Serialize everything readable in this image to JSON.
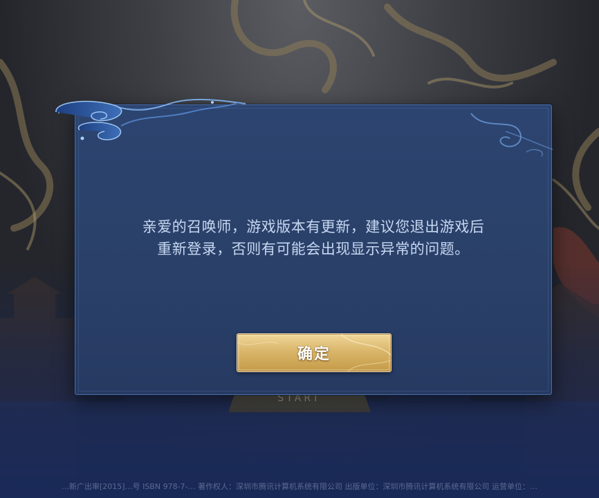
{
  "dialog": {
    "message_lines": [
      "亲爱的召唤师，游戏版本有更新，建议您退出游戏后",
      "重新登录，否则有可能会出现显示异常的问题。"
    ],
    "confirm_label": "确定"
  },
  "background": {
    "start_label": "START",
    "footer_text": "…新广出审[2015]…号  ISBN 978-7-…  著作权人：深圳市腾讯计算机系统有限公司  出版单位：深圳市腾讯计算机系统有限公司  运营单位：…"
  },
  "colors": {
    "dialog_bg": "#2a4068",
    "dialog_border": "#4d6ea8",
    "message_text": "#c7d8f2",
    "button_gold": "#d9b66b",
    "button_text": "#ffffff"
  },
  "icons": {
    "dialog_ornament": "cloud-swirl-ornament"
  }
}
